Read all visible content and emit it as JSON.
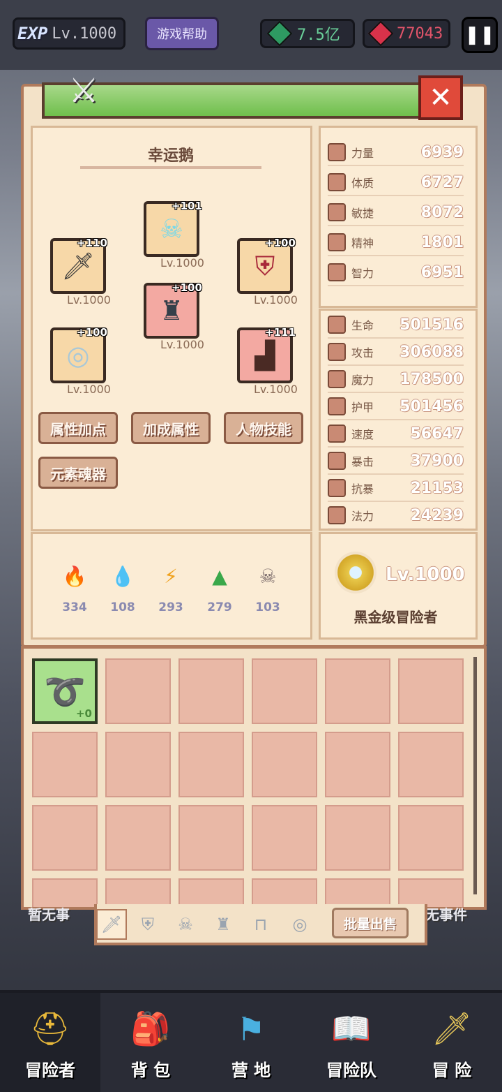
{
  "topbar": {
    "exp_badge": "EXP",
    "level": "Lv.1000",
    "help_label": "游戏帮助",
    "gold_amount": "7.5亿",
    "gem_amount": "77043",
    "gold_color": "#2e9a62",
    "gem_color": "#d8324a"
  },
  "panel": {
    "hero_name": "幸运鹅",
    "equipment": [
      {
        "slot": "helmet",
        "icon": "skull-mask-icon",
        "plus": "+101",
        "level": "Lv.1000",
        "frame": "gold"
      },
      {
        "slot": "weapon",
        "icon": "dagger-icon",
        "plus": "+110",
        "level": "Lv.1000",
        "frame": "gold"
      },
      {
        "slot": "shield",
        "icon": "shield-icon",
        "plus": "+100",
        "level": "Lv.1000",
        "frame": "gold"
      },
      {
        "slot": "armor",
        "icon": "armor-icon",
        "plus": "+100",
        "level": "Lv.1000",
        "frame": "red"
      },
      {
        "slot": "ring",
        "icon": "ring-icon",
        "plus": "+100",
        "level": "Lv.1000",
        "frame": "gold"
      },
      {
        "slot": "boots",
        "icon": "boots-icon",
        "plus": "+111",
        "level": "Lv.1000",
        "frame": "red"
      }
    ],
    "buttons": {
      "attr_points": "属性加点",
      "bonus_attr": "加成属性",
      "skills": "人物技能",
      "element_soul": "元素魂器"
    },
    "elements": [
      {
        "icon": "fire-icon",
        "value": "334"
      },
      {
        "icon": "water-icon",
        "value": "108"
      },
      {
        "icon": "lightning-icon",
        "value": "293"
      },
      {
        "icon": "earth-icon",
        "value": "279"
      },
      {
        "icon": "dark-icon",
        "value": "103"
      }
    ],
    "base_stats": [
      {
        "label": "力量",
        "value": "6939"
      },
      {
        "label": "体质",
        "value": "6727"
      },
      {
        "label": "敏捷",
        "value": "8072"
      },
      {
        "label": "精神",
        "value": "1801"
      },
      {
        "label": "智力",
        "value": "6951"
      }
    ],
    "combat_stats": [
      {
        "label": "生命",
        "value": "501516"
      },
      {
        "label": "攻击",
        "value": "306088"
      },
      {
        "label": "魔力",
        "value": "178500"
      },
      {
        "label": "护甲",
        "value": "501456"
      },
      {
        "label": "速度",
        "value": "56647"
      },
      {
        "label": "暴击",
        "value": "37900"
      },
      {
        "label": "抗暴",
        "value": "21153"
      },
      {
        "label": "法力",
        "value": "24239"
      }
    ],
    "rank": {
      "level": "Lv.1000",
      "title": "黑金级冒险者"
    }
  },
  "inventory": {
    "items": [
      {
        "icon": "whip-icon",
        "plus": "+0"
      }
    ],
    "sell_label": "批量出售",
    "tabs": [
      "sword-icon",
      "shield-icon",
      "helmet-icon",
      "armor-icon",
      "table-icon",
      "ring-icon"
    ]
  },
  "side_text": {
    "left": "暂无事",
    "right": "无事件"
  },
  "nav": [
    {
      "icon": "helmet-icon",
      "label": "冒险者"
    },
    {
      "icon": "backpack-icon",
      "label": "背 包"
    },
    {
      "icon": "banner-icon",
      "label": "营 地"
    },
    {
      "icon": "book-icon",
      "label": "冒险队"
    },
    {
      "icon": "sword-icon",
      "label": "冒 险"
    }
  ]
}
